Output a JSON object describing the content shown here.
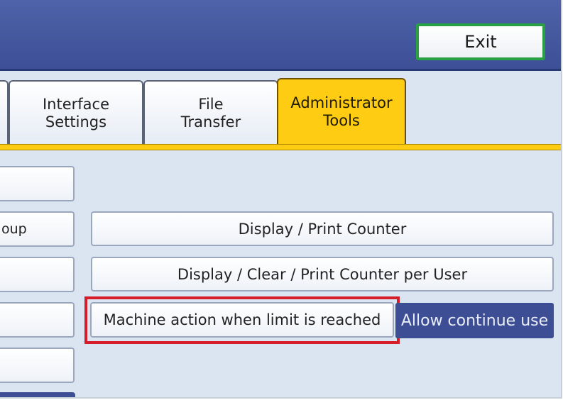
{
  "header": {
    "exit_label": "Exit"
  },
  "tabs": [
    {
      "label": "Interface\nSettings"
    },
    {
      "label": "File\nTransfer"
    },
    {
      "label": "Administrator\nTools",
      "selected": true
    }
  ],
  "left_buttons": [
    "",
    "oup",
    "",
    "",
    ""
  ],
  "main": {
    "display_print_counter": "Display / Print Counter",
    "display_clear_print_counter_per_user": "Display / Clear / Print Counter per User",
    "machine_action_label": "Machine action when limit is reached",
    "machine_action_value": "Allow continue use"
  },
  "colors": {
    "header": "#3d4f96",
    "exit_border": "#29a043",
    "selected_tab": "#ffcc14",
    "highlight": "#d61e2a",
    "value_bg": "#3d4e95",
    "panel_bg": "#dbe5f2"
  }
}
